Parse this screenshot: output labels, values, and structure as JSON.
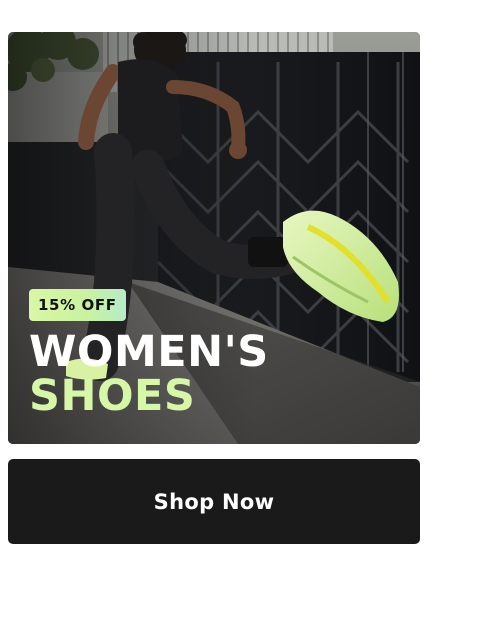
{
  "promo": {
    "badge": "15% OFF",
    "headline_line1": "WOMEN'S",
    "headline_line2": "SHOES",
    "image_subject": "runner-in-neon-sneakers"
  },
  "cta": {
    "label": "Shop Now"
  },
  "colors": {
    "accent": "#d6f7a6",
    "button_bg": "#1a1a1a",
    "headline_white": "#ffffff"
  }
}
